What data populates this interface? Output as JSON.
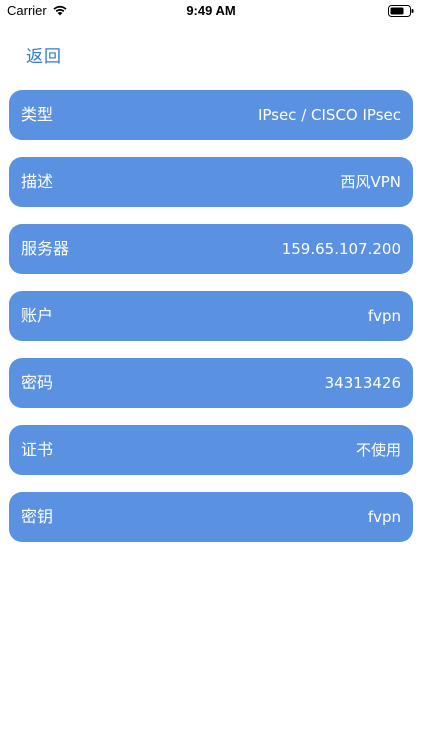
{
  "status_bar": {
    "carrier": "Carrier",
    "time": "9:49 AM",
    "wifi_icon": "wifi-icon",
    "battery_icon": "battery-icon"
  },
  "nav": {
    "back_label": "返回",
    "back_color": "#2f7ad6"
  },
  "theme": {
    "row_background": "#5b91e1",
    "row_text_color": "#ffffff"
  },
  "rows": [
    {
      "label": "类型",
      "value": "IPsec  /  CISCO IPsec"
    },
    {
      "label": "描述",
      "value": "西风VPN"
    },
    {
      "label": "服务器",
      "value": "159.65.107.200"
    },
    {
      "label": "账户",
      "value": "fvpn"
    },
    {
      "label": "密码",
      "value": "34313426"
    },
    {
      "label": "证书",
      "value": "不使用"
    },
    {
      "label": "密钥",
      "value": "fvpn"
    }
  ]
}
